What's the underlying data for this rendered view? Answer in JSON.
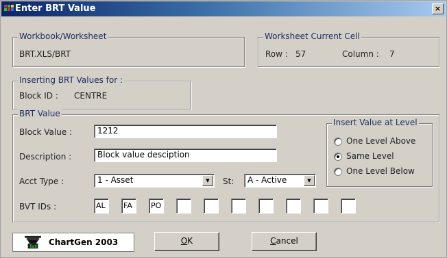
{
  "window": {
    "title": "Enter BRT Value",
    "close_label": "×"
  },
  "workbook": {
    "legend": "Workbook/Worksheet",
    "value": "BRT.XLS/BRT"
  },
  "current_cell": {
    "legend": "Worksheet Current Cell",
    "row_label": "Row :",
    "row_value": "57",
    "column_label": "Column :",
    "column_value": "7"
  },
  "inserting": {
    "legend": "Inserting BRT Values for :",
    "block_id_label": "Block ID :",
    "block_id_value": "CENTRE"
  },
  "brt_value": {
    "legend": "BRT Value",
    "block_value_label": "Block Value :",
    "block_value": "1212",
    "description_label": "Description :",
    "description_value": "Block value desciption",
    "acct_type_label": "Acct Type :",
    "acct_type_value": "1 - Asset",
    "st_label": "St:",
    "st_value": "A - Active",
    "bvt_label": "BVT IDs :",
    "bvt_ids": [
      "AL",
      "FA",
      "PO",
      "",
      "",
      "",
      "",
      "",
      "",
      ""
    ]
  },
  "level": {
    "legend": "Insert Value at Level",
    "options": [
      "One Level Above",
      "Same Level",
      "One Level Below"
    ],
    "selected": "Same Level"
  },
  "footer": {
    "brand": "ChartGen 2003",
    "ok_ul": "O",
    "ok_rest": "K",
    "cancel_ul": "C",
    "cancel_rest": "ancel"
  }
}
